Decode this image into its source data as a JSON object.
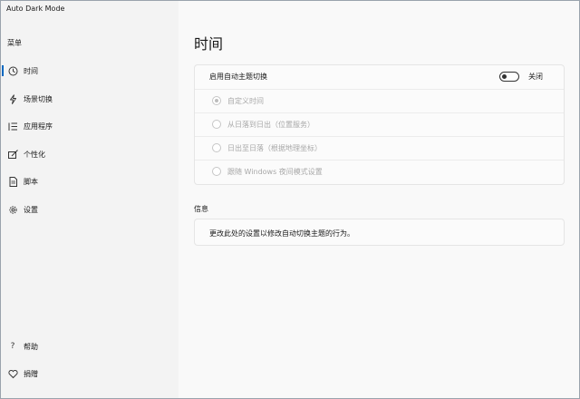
{
  "app": {
    "title": "Auto Dark Mode",
    "controls": {
      "minimize": "—",
      "maximize": "☐",
      "close": "✕"
    }
  },
  "sidebar": {
    "menu_title": "菜单",
    "items": [
      {
        "label": "时间",
        "icon": "clock-icon",
        "active": true
      },
      {
        "label": "场景切换",
        "icon": "lightning-icon",
        "active": false
      },
      {
        "label": "应用程序",
        "icon": "app-list-icon",
        "active": false
      },
      {
        "label": "个性化",
        "icon": "personalize-icon",
        "active": false
      },
      {
        "label": "脚本",
        "icon": "script-icon",
        "active": false
      },
      {
        "label": "设置",
        "icon": "gear-icon",
        "active": false
      }
    ],
    "bottom_items": [
      {
        "label": "帮助",
        "icon": "help-icon"
      },
      {
        "label": "捐赠",
        "icon": "heart-icon"
      }
    ]
  },
  "main": {
    "page_title": "时间",
    "toggle": {
      "label": "启用自动主题切换",
      "state_label": "关闭",
      "on": false
    },
    "radio_options": [
      {
        "label": "自定义时间",
        "checked": true
      },
      {
        "label": "从日落到日出（位置服务）",
        "checked": false
      },
      {
        "label": "日出至日落（根据地理坐标）",
        "checked": false
      },
      {
        "label": "跟随 Windows 夜间模式设置",
        "checked": false
      }
    ],
    "info": {
      "header": "信息",
      "text": "更改此处的设置以修改自动切换主题的行为。"
    }
  },
  "colors": {
    "accent": "#0067c0",
    "sidebar_bg": "#f3f3f3",
    "main_bg": "#f9f9f9",
    "disabled_text": "#a8a8a8"
  }
}
